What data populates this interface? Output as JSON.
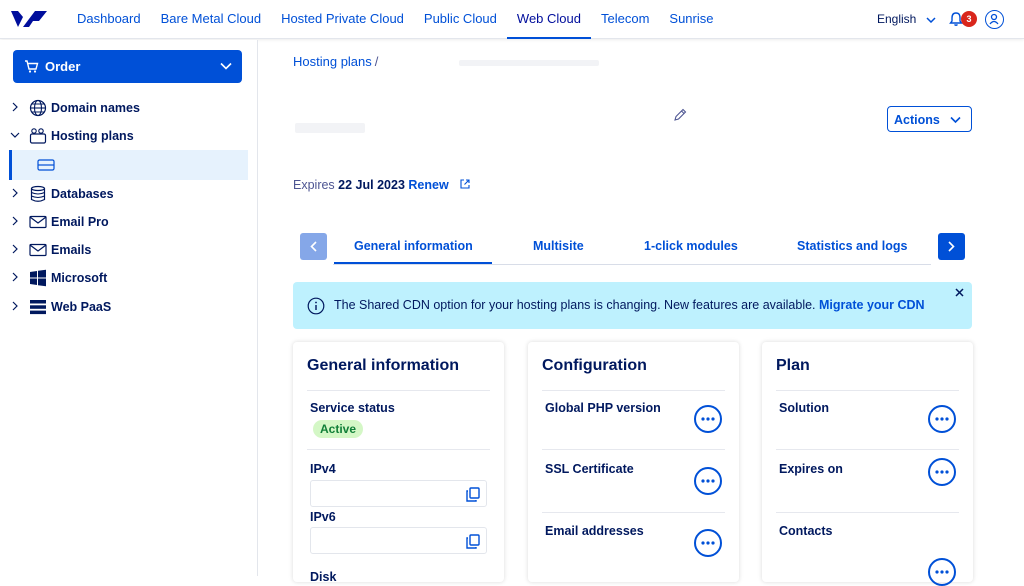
{
  "nav": {
    "items": [
      "Dashboard",
      "Bare Metal Cloud",
      "Hosted Private Cloud",
      "Public Cloud",
      "Web Cloud",
      "Telecom",
      "Sunrise"
    ],
    "active": "Web Cloud",
    "language": "English",
    "notifications_count": "3"
  },
  "sidebar": {
    "order_label": "Order",
    "items": [
      {
        "label": "Domain names",
        "icon": "globe-icon"
      },
      {
        "label": "Hosting plans",
        "icon": "hosting-icon"
      },
      {
        "label": "Databases",
        "icon": "database-icon"
      },
      {
        "label": "Email Pro",
        "icon": "mail-icon"
      },
      {
        "label": "Emails",
        "icon": "mail-icon"
      },
      {
        "label": "Microsoft",
        "icon": "windows-icon"
      },
      {
        "label": "Web PaaS",
        "icon": "stack-icon"
      }
    ]
  },
  "main": {
    "breadcrumb": {
      "root": "Hosting plans",
      "sep": "/"
    },
    "actions_label": "Actions",
    "expires": {
      "prefix": "Expires",
      "date": "22 Jul 2023",
      "renew": "Renew"
    },
    "tabs": [
      "General information",
      "Multisite",
      "1-click modules",
      "Statistics and logs"
    ],
    "active_tab": "General information",
    "banner": {
      "text": "The Shared CDN option for your hosting plans is changing. New features are available.",
      "link": "Migrate your CDN"
    },
    "cards": {
      "general": {
        "title": "General information",
        "service_status_label": "Service status",
        "service_status_value": "Active",
        "ipv4_label": "IPv4",
        "ipv6_label": "IPv6",
        "disk_label": "Disk"
      },
      "config": {
        "title": "Configuration",
        "rows": [
          "Global PHP version",
          "SSL Certificate",
          "Email addresses"
        ]
      },
      "plan": {
        "title": "Plan",
        "rows": [
          "Solution",
          "Expires on",
          "Contacts"
        ]
      }
    }
  },
  "colors": {
    "accent": "#0050d7",
    "text": "#00185e",
    "banner": "#bef1fe",
    "active_pill": "#d4f7c6"
  }
}
